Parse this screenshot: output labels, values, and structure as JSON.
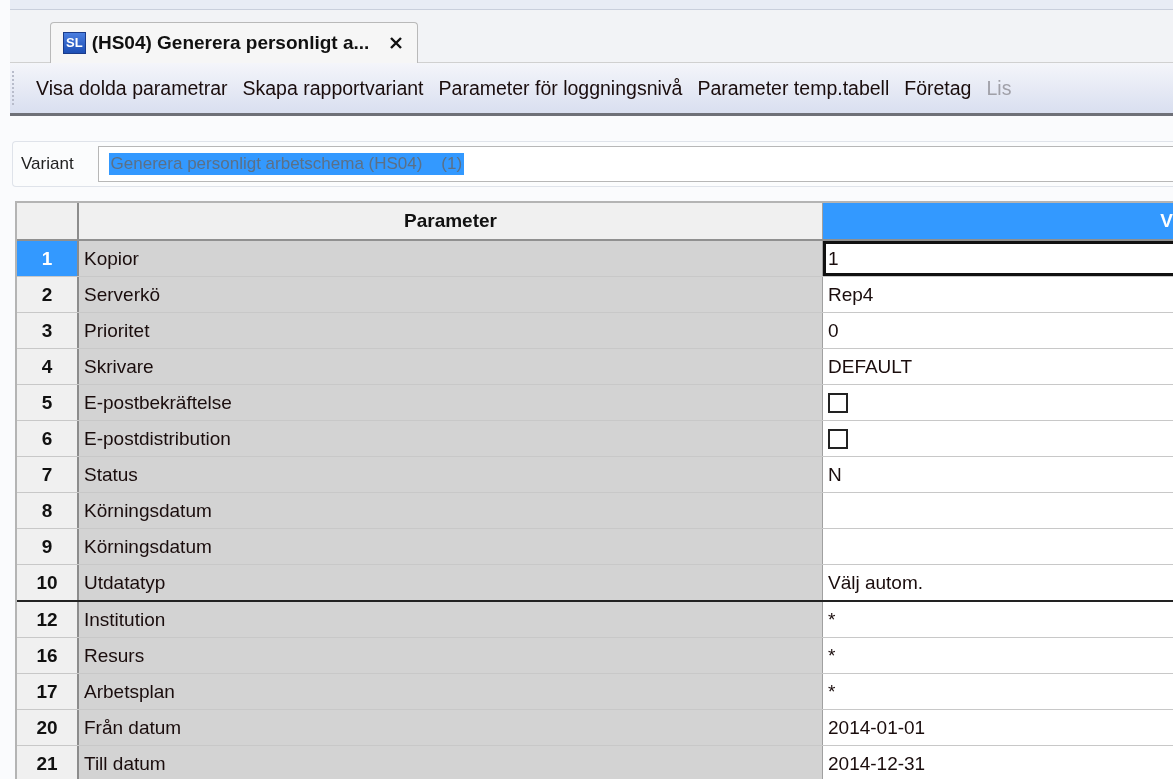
{
  "tab": {
    "icon_label": "SL",
    "title": "(HS04) Generera personligt a..."
  },
  "toolbar": [
    {
      "label": "Visa dolda parametrar",
      "disabled": false
    },
    {
      "label": "Skapa rapportvariant",
      "disabled": false
    },
    {
      "label": "Parameter för loggningsnivå",
      "disabled": false
    },
    {
      "label": "Parameter temp.tabell",
      "disabled": false
    },
    {
      "label": "Företag",
      "disabled": false
    },
    {
      "label": "Lis",
      "disabled": true
    }
  ],
  "variant": {
    "label": "Variant",
    "value": "Generera personligt arbetschema (HS04)    (1)",
    "selected": true
  },
  "grid": {
    "columns": [
      {
        "label": "Parameter",
        "selected": false
      },
      {
        "label": "V",
        "selected": true
      }
    ],
    "rows": [
      {
        "number": "1",
        "parameter": "Kopior",
        "kind": "text",
        "value": "1",
        "selected": true,
        "separator_after": false
      },
      {
        "number": "2",
        "parameter": "Serverkö",
        "kind": "text",
        "value": "Rep4",
        "selected": false,
        "separator_after": false
      },
      {
        "number": "3",
        "parameter": "Prioritet",
        "kind": "text",
        "value": "0",
        "selected": false,
        "separator_after": false
      },
      {
        "number": "4",
        "parameter": "Skrivare",
        "kind": "text",
        "value": "DEFAULT",
        "selected": false,
        "separator_after": false
      },
      {
        "number": "5",
        "parameter": "E-postbekräftelse",
        "kind": "checkbox",
        "checked": false,
        "selected": false,
        "separator_after": false
      },
      {
        "number": "6",
        "parameter": "E-postdistribution",
        "kind": "checkbox",
        "checked": false,
        "selected": false,
        "separator_after": false
      },
      {
        "number": "7",
        "parameter": "Status",
        "kind": "text",
        "value": "N",
        "selected": false,
        "separator_after": false
      },
      {
        "number": "8",
        "parameter": "Körningsdatum",
        "kind": "text",
        "selected": false,
        "separator_after": false
      },
      {
        "number": "9",
        "parameter": "Körningsdatum",
        "kind": "text",
        "selected": false,
        "separator_after": false
      },
      {
        "number": "10",
        "parameter": "Utdatatyp",
        "kind": "text",
        "value": "Välj autom.",
        "selected": false,
        "separator_after": true
      },
      {
        "number": "12",
        "parameter": "Institution",
        "kind": "text",
        "value": "*",
        "selected": false,
        "separator_after": false
      },
      {
        "number": "16",
        "parameter": "Resurs",
        "kind": "text",
        "value": "*",
        "selected": false,
        "separator_after": false
      },
      {
        "number": "17",
        "parameter": "Arbetsplan",
        "kind": "text",
        "value": "*",
        "selected": false,
        "separator_after": false
      },
      {
        "number": "20",
        "parameter": "Från datum",
        "kind": "text",
        "value": "2014-01-01",
        "selected": false,
        "separator_after": false
      },
      {
        "number": "21",
        "parameter": "Till datum",
        "kind": "text",
        "value": "2014-12-31",
        "selected": false,
        "separator_after": false
      }
    ]
  }
}
